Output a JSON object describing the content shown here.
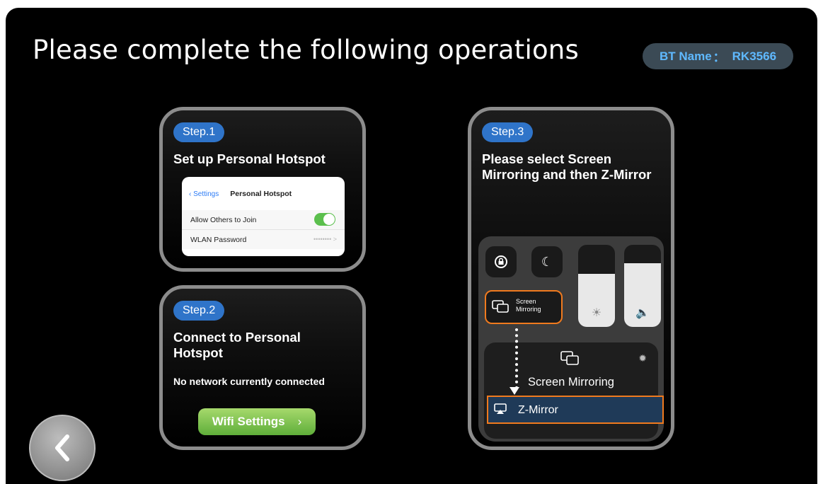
{
  "page": {
    "title": "Please complete the following operations",
    "bt_label": "BT Name",
    "bt_sep": "：",
    "bt_value": "RK3566"
  },
  "step1": {
    "badge": "Step.1",
    "title": "Set up Personal Hotspot",
    "mock": {
      "back_label": "Settings",
      "header": "Personal Hotspot",
      "row1_label": "Allow Others to Join",
      "row2_label": "WLAN Password",
      "password_mask": "•••••••• >"
    }
  },
  "step2": {
    "badge": "Step.2",
    "title": "Connect to Personal Hotspot",
    "status": "No network currently connected",
    "button": "Wifi Settings"
  },
  "step3": {
    "badge": "Step.3",
    "title": "Please select Screen Mirroring and then Z-Mirror",
    "tile_label_line1": "Screen",
    "tile_label_line2": "Mirroring",
    "panel_title": "Screen Mirroring",
    "device": "Z-Mirror",
    "brightness_level": 0.65,
    "volume_level": 0.78
  },
  "colors": {
    "accent_blue": "#2f74c9",
    "highlight_orange": "#f07a1e",
    "button_green": "#7cc04f"
  }
}
